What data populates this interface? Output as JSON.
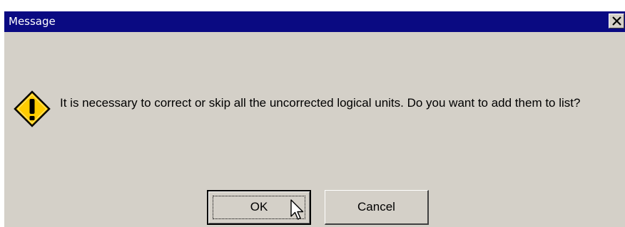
{
  "window": {
    "title": "Message",
    "close_icon": "close-icon"
  },
  "dialog": {
    "icon": "warning-icon",
    "message": "It is necessary to correct or skip all the uncorrected logical units. Do you want to add them to list?"
  },
  "buttons": {
    "ok_label": "OK",
    "cancel_label": "Cancel"
  },
  "colors": {
    "titlebar": "#0a0a82",
    "dialog_bg": "#d4d0c8",
    "warning_fill": "#ffcc00"
  }
}
